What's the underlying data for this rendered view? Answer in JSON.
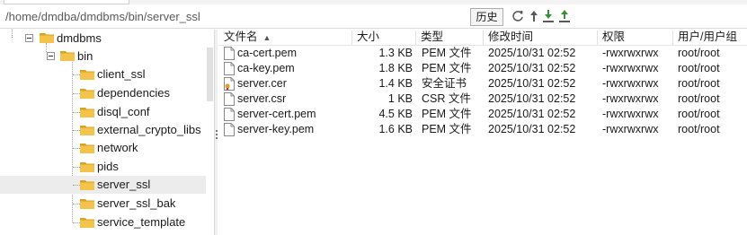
{
  "toolbar": {
    "path": "/home/dmdba/dmdbms/bin/server_ssl",
    "history_label": "历史",
    "icons": [
      "refresh-icon",
      "up-arrow-icon",
      "download-icon",
      "upload-icon"
    ]
  },
  "tree": {
    "root": "dmdbms",
    "bin": "bin",
    "children": [
      "client_ssl",
      "dependencies",
      "disql_conf",
      "external_crypto_libs",
      "network",
      "pids",
      "server_ssl",
      "server_ssl_bak",
      "service_template"
    ],
    "selected": "server_ssl"
  },
  "list": {
    "columns": [
      "文件名",
      "大小",
      "类型",
      "修改时间",
      "权限",
      "用户/用户组"
    ],
    "sort_indicator": "▲",
    "rows": [
      {
        "name": "ca-cert.pem",
        "size": "1.3 KB",
        "type": "PEM 文件",
        "mtime": "2025/10/31 02:52",
        "perm": "-rwxrwxrwx",
        "owner": "root/root",
        "icon": "file-icon"
      },
      {
        "name": "ca-key.pem",
        "size": "1.8 KB",
        "type": "PEM 文件",
        "mtime": "2025/10/31 02:52",
        "perm": "-rwxrwxrwx",
        "owner": "root/root",
        "icon": "file-icon"
      },
      {
        "name": "server.cer",
        "size": "1.4 KB",
        "type": "安全证书",
        "mtime": "2025/10/31 02:52",
        "perm": "-rwxrwxrwx",
        "owner": "root/root",
        "icon": "certificate-icon"
      },
      {
        "name": "server.csr",
        "size": "1 KB",
        "type": "CSR 文件",
        "mtime": "2025/10/31 02:52",
        "perm": "-rwxrwxrwx",
        "owner": "root/root",
        "icon": "file-icon"
      },
      {
        "name": "server-cert.pem",
        "size": "4.5 KB",
        "type": "PEM 文件",
        "mtime": "2025/10/31 02:52",
        "perm": "-rwxrwxrwx",
        "owner": "root/root",
        "icon": "file-icon"
      },
      {
        "name": "server-key.pem",
        "size": "1.6 KB",
        "type": "PEM 文件",
        "mtime": "2025/10/31 02:52",
        "perm": "-rwxrwxrwx",
        "owner": "root/root",
        "icon": "file-icon"
      }
    ]
  },
  "colors": {
    "folder": "#f3c34a",
    "folder_dark": "#d9a21f",
    "selection": "#ececec",
    "arrow_green": "#3a8e3a"
  }
}
